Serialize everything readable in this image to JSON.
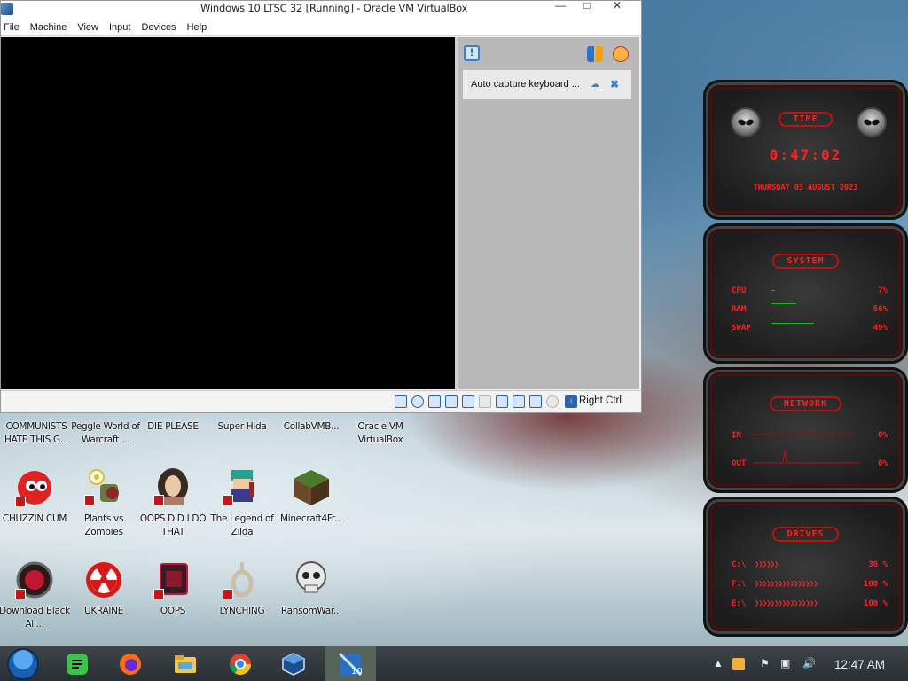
{
  "vbox": {
    "title": "Windows 10 LTSC 32 [Running] - Oracle VM VirtualBox",
    "menu": [
      "File",
      "Machine",
      "View",
      "Input",
      "Devices",
      "Help"
    ],
    "notification": {
      "text": "Auto capture keyboard ..."
    },
    "status": {
      "host_key": "Right Ctrl"
    }
  },
  "desktop": {
    "top_row_labels": [
      "COMMUNISTS HATE THIS G...",
      "Peggle World of Warcraft ...",
      "DIE PLEASE",
      "Super Hida",
      "CollabVMB...",
      "Oracle VM VirtualBox"
    ],
    "icons_row2": [
      {
        "label": "CHUZZIN CUM",
        "icon": "chuzzle-icon"
      },
      {
        "label": "Plants vs Zombies",
        "icon": "plants-vs-zombies-icon"
      },
      {
        "label": "OOPS DID I DO THAT",
        "icon": "portrait-icon"
      },
      {
        "label": "The Legend of Zilda",
        "icon": "legend-of-zilda-icon"
      },
      {
        "label": "Minecraft4Fr...",
        "icon": "minecraft-icon"
      }
    ],
    "icons_row3": [
      {
        "label": "Download Black All...",
        "icon": "download-orb-icon"
      },
      {
        "label": "UKRAINE",
        "icon": "radiation-icon"
      },
      {
        "label": "OOPS",
        "icon": "oops-icon"
      },
      {
        "label": "LYNCHING",
        "icon": "noose-icon"
      },
      {
        "label": "RansomWar...",
        "icon": "skull-icon"
      }
    ]
  },
  "gadget": {
    "time": {
      "title": "TIME",
      "clock": "0:47:02",
      "date": "THURSDAY 03 AUGUST 2023"
    },
    "system": {
      "title": "SYSTEM",
      "rows": [
        {
          "label": "CPU",
          "value": "7%",
          "level": 0.07
        },
        {
          "label": "RAM",
          "value": "56%",
          "level": 0.56
        },
        {
          "label": "SWAP",
          "value": "49%",
          "level": 0.49
        }
      ]
    },
    "network": {
      "title": "NETWORK",
      "rows": [
        {
          "label": "IN",
          "value": "0%"
        },
        {
          "label": "OUT",
          "value": "0%"
        }
      ]
    },
    "drives": {
      "title": "DRIVES",
      "rows": [
        {
          "label": "C:\\",
          "value": "36 %",
          "level": 0.36
        },
        {
          "label": "F:\\",
          "value": "100 %",
          "level": 1.0
        },
        {
          "label": "E:\\",
          "value": "100 %",
          "level": 1.0
        }
      ]
    },
    "accent": "#ff2020"
  },
  "taskbar": {
    "apps": [
      "start-orb-icon",
      "notes-icon",
      "firefox-icon",
      "file-explorer-icon",
      "chrome-icon",
      "virtualbox-icon",
      "vm-windows10-icon"
    ],
    "clock": "12:47 AM"
  }
}
